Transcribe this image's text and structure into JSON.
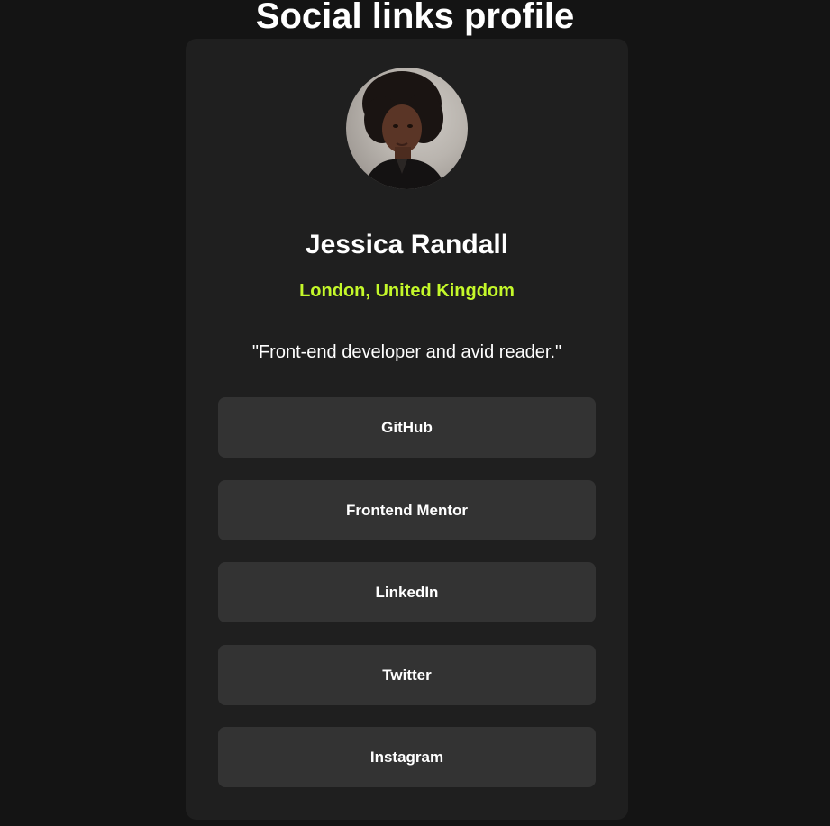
{
  "page": {
    "heading": "Social links profile"
  },
  "profile": {
    "name": "Jessica Randall",
    "location": "London, United Kingdom",
    "bio": "\"Front-end developer and avid reader.\"",
    "avatar_icon": "profile-photo"
  },
  "links": [
    {
      "label": "GitHub"
    },
    {
      "label": "Frontend Mentor"
    },
    {
      "label": "LinkedIn"
    },
    {
      "label": "Twitter"
    },
    {
      "label": "Instagram"
    }
  ],
  "colors": {
    "background": "#141414",
    "card": "#1f1f1f",
    "button": "#333333",
    "accent": "#c4f82a",
    "text": "#ffffff"
  }
}
